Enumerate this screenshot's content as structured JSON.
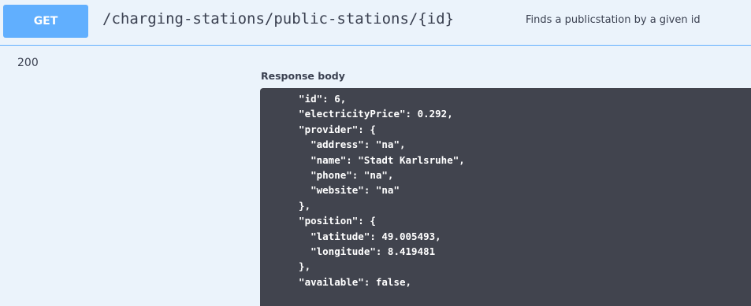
{
  "opblock": {
    "method": "GET",
    "path": "/charging-stations/public-stations/{id}",
    "description": "Finds a publicstation by a given id"
  },
  "response": {
    "status_code": "200",
    "body_label": "Response body",
    "body_text": "  \"id\": 6,\n  \"electricityPrice\": 0.292,\n  \"provider\": {\n    \"address\": \"na\",\n    \"name\": \"Stadt Karlsruhe\",\n    \"phone\": \"na\",\n    \"website\": \"na\"\n  },\n  \"position\": {\n    \"latitude\": 49.005493,\n    \"longitude\": 8.419481\n  },\n  \"available\": false,"
  },
  "colors": {
    "get_method": "#61affe",
    "block_background": "#ebf3fb",
    "code_background": "#41444e"
  }
}
